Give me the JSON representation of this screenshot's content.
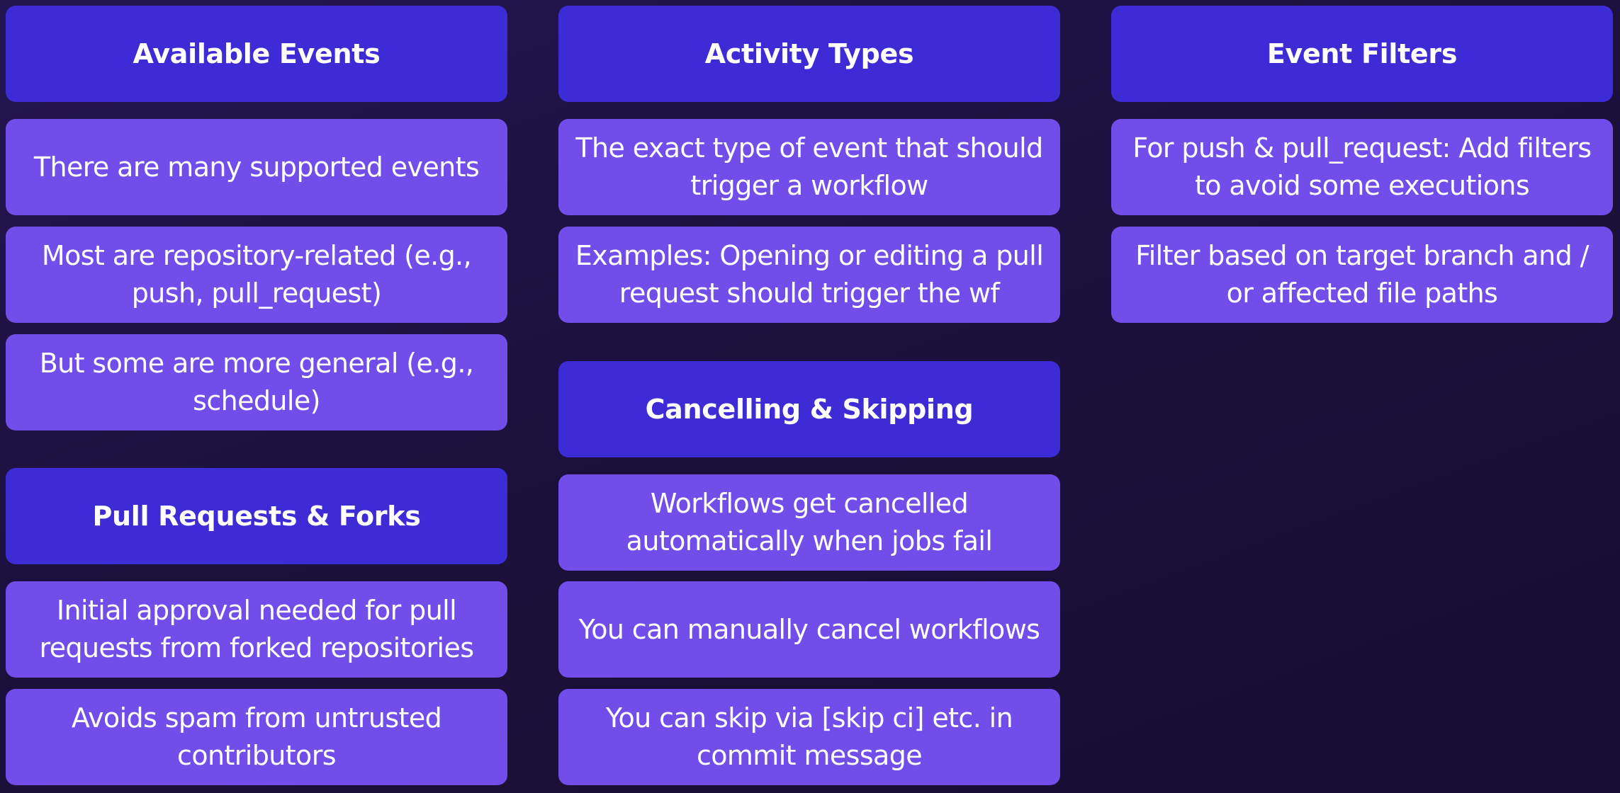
{
  "columns": {
    "available_events": {
      "title": "Available Events",
      "items": [
        "There are many supported events",
        "Most are repository-related (e.g., push, pull_request)",
        "But some are more general (e.g., schedule)"
      ]
    },
    "activity_types": {
      "title": "Activity Types",
      "items": [
        "The exact type of event that should trigger a workflow",
        "Examples: Opening or editing a pull request should trigger the wf"
      ]
    },
    "event_filters": {
      "title": "Event Filters",
      "items": [
        "For push & pull_request: Add filters to avoid some executions",
        "Filter based on target branch and / or affected file paths"
      ]
    },
    "pull_requests_forks": {
      "title": "Pull Requests & Forks",
      "items": [
        "Initial approval needed for pull requests from forked repositories",
        "Avoids spam from untrusted contributors"
      ]
    },
    "cancelling_skipping": {
      "title": "Cancelling & Skipping",
      "items": [
        "Workflows get cancelled automatically when jobs fail",
        "You can manually cancel workflows",
        "You can skip via [skip ci] etc. in commit message"
      ]
    }
  },
  "colors": {
    "background": "#1b1140",
    "header_box": "#3d2bd6",
    "item_box": "#714ee9",
    "text": "#ffffff"
  }
}
